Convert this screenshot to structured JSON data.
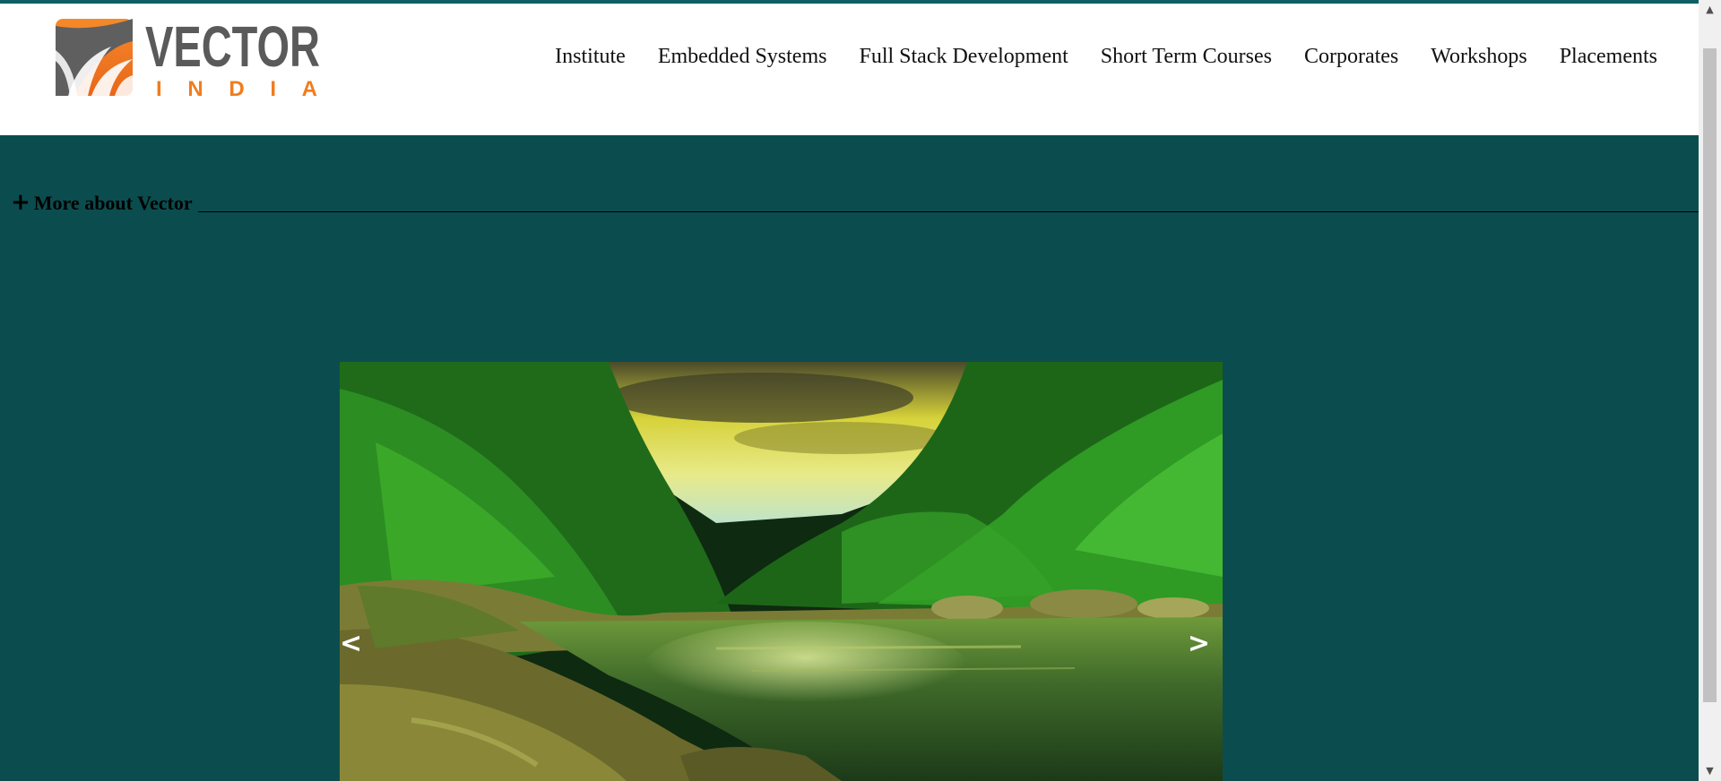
{
  "brand": {
    "name_top": "VECTOR",
    "name_bottom": "INDIA",
    "colors": {
      "orange": "#f07d1e",
      "grey": "#5a5a5a",
      "teal": "#0b4d4f"
    }
  },
  "nav": {
    "items": [
      {
        "label": "Institute"
      },
      {
        "label": "Embedded Systems"
      },
      {
        "label": "Full Stack Development"
      },
      {
        "label": "Short Term Courses"
      },
      {
        "label": "Corporates"
      },
      {
        "label": "Workshops"
      },
      {
        "label": "Placements"
      }
    ]
  },
  "more": {
    "icon": "plus-icon",
    "label": "More about Vector"
  },
  "slider": {
    "prev_label": "<",
    "next_label": ">"
  },
  "scrollbar": {
    "up_icon": "scroll-up-arrow",
    "down_icon": "scroll-down-arrow"
  }
}
